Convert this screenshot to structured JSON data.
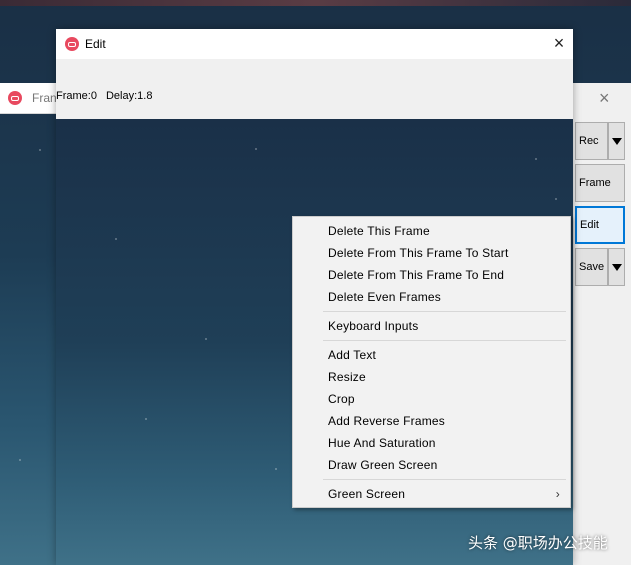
{
  "background_window": {
    "title": "Fran",
    "close_glyph": "×",
    "buttons": {
      "rec": "Rec",
      "frame": "Frame",
      "edit": "Edit",
      "save": "Save"
    }
  },
  "edit_window": {
    "title": "Edit",
    "close_glyph": "×",
    "frame_label": "Frame:0",
    "delay_label": "Delay:1.8"
  },
  "context_menu": {
    "items": [
      "Delete This Frame",
      "Delete From This Frame To Start",
      "Delete From This Frame To End",
      "Delete Even Frames",
      "Keyboard Inputs",
      "Add Text",
      "Resize",
      "Crop",
      "Add Reverse Frames",
      "Hue And Saturation",
      "Draw Green Screen",
      "Green Screen"
    ],
    "submenu_arrow": "›"
  },
  "watermark": "头条 @职场办公技能",
  "colors": {
    "accent": "#0078d7",
    "app_icon": "#e8495f",
    "menu_bg": "#f2f2f2"
  }
}
